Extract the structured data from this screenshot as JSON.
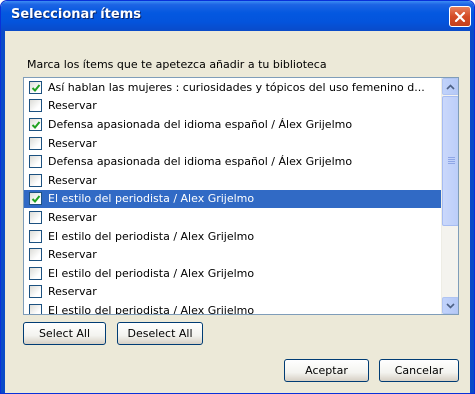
{
  "window": {
    "title": "Seleccionar ítems",
    "close_icon": "close-icon"
  },
  "prompt": "Marca los ítems que te apetezca añadir a tu biblioteca",
  "list": {
    "items": [
      {
        "label": "Así hablan las mujeres : curiosidades y tópicos del uso femenino d...",
        "checked": true,
        "selected": false
      },
      {
        "label": "Reservar",
        "checked": false,
        "selected": false
      },
      {
        "label": "Defensa apasionada del idioma español / Álex Grijelmo",
        "checked": true,
        "selected": false
      },
      {
        "label": "Reservar",
        "checked": false,
        "selected": false
      },
      {
        "label": "Defensa apasionada del idioma español / Álex Grijelmo",
        "checked": false,
        "selected": false
      },
      {
        "label": "Reservar",
        "checked": false,
        "selected": false
      },
      {
        "label": "El estilo del periodista / Alex Grijelmo",
        "checked": true,
        "selected": true
      },
      {
        "label": "Reservar",
        "checked": false,
        "selected": false
      },
      {
        "label": "El estilo del periodista / Alex Grijelmo",
        "checked": false,
        "selected": false
      },
      {
        "label": "Reservar",
        "checked": false,
        "selected": false
      },
      {
        "label": "El estilo del periodista / Alex Grijelmo",
        "checked": false,
        "selected": false
      },
      {
        "label": "Reservar",
        "checked": false,
        "selected": false
      },
      {
        "label": "El estilo del periodista / Alex Grijelmo",
        "checked": false,
        "selected": false
      }
    ]
  },
  "buttons": {
    "select_all": "Select All",
    "deselect_all": "Deselect All",
    "accept": "Aceptar",
    "cancel": "Cancelar"
  },
  "colors": {
    "title_bar": "#0454dc",
    "selection": "#316ac5",
    "close_button": "#d54c26",
    "dialog_face": "#ece9d8",
    "checkmark": "#21a121"
  }
}
